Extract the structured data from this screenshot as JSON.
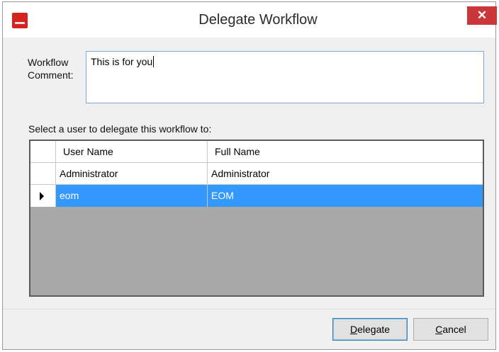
{
  "window": {
    "title": "Delegate Workflow",
    "close_symbol": "✕",
    "icon": "app-logo-icon"
  },
  "comment": {
    "label": "Workflow Comment:",
    "value": "This is for you"
  },
  "select_label": "Select a user to delegate this workflow to:",
  "grid": {
    "columns": [
      "User Name",
      "Full Name"
    ],
    "rows": [
      {
        "user_name": "Administrator",
        "full_name": "Administrator",
        "selected": false
      },
      {
        "user_name": "eom",
        "full_name": "EOM",
        "selected": true
      }
    ]
  },
  "buttons": {
    "delegate": {
      "underline": "D",
      "rest": "elegate"
    },
    "cancel": {
      "underline": "C",
      "rest": "ancel"
    }
  },
  "colors": {
    "selection": "#3399ff",
    "close_button": "#c9373a",
    "grid_empty": "#a9a9a9"
  }
}
